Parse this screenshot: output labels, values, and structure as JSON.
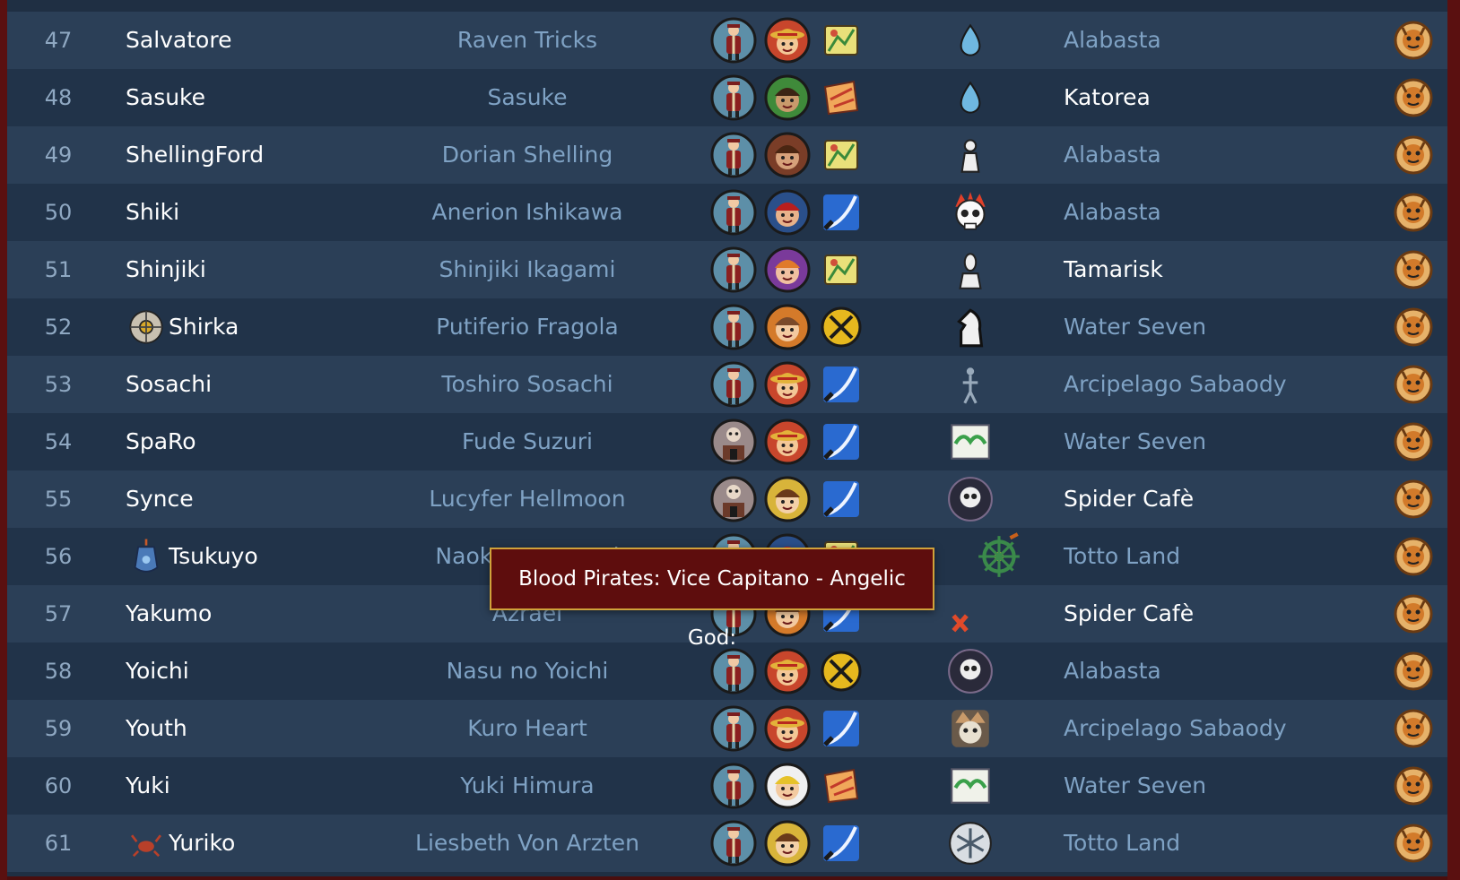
{
  "colors": {
    "row_odd": "#2b3f57",
    "row_even": "#213349",
    "number_text": "#8fa8c2",
    "nick_text": "#ffffff",
    "character_text": "#7fa2c4",
    "island_dim": "#7fa2c4",
    "island_highlight": "#ffffff",
    "tooltip_bg": "#5e0d0d",
    "tooltip_border": "#d0a23a",
    "frame_border": "#5a1010"
  },
  "tooltip": {
    "text": "Blood Pirates: Vice Capitano - Angelic God:"
  },
  "rows": [
    {
      "num": "47",
      "nick": "Salvatore",
      "character": "Raven Tricks",
      "badges": [
        "marine-officer-icon",
        "straw-hat-face-icon",
        "map-scroll-icon"
      ],
      "crew_icon": "water-drop-icon",
      "island": "Alabasta",
      "island_highlight": false,
      "action_icon": "den-den-mushi-icon"
    },
    {
      "num": "48",
      "nick": "Sasuke",
      "character": "Sasuke",
      "badges": [
        "marine-officer-icon",
        "green-face-icon",
        "broken-scroll-icon"
      ],
      "crew_icon": "water-drop-icon",
      "island": "Katorea",
      "island_highlight": true,
      "action_icon": "den-den-mushi-icon"
    },
    {
      "num": "49",
      "nick": "ShellingFord",
      "character": "Dorian Shelling",
      "badges": [
        "marine-officer-icon",
        "brown-face-icon",
        "map-scroll-icon"
      ],
      "crew_icon": "chess-pawn-icon",
      "island": "Alabasta",
      "island_highlight": false,
      "action_icon": "den-den-mushi-icon"
    },
    {
      "num": "50",
      "nick": "Shiki",
      "character": "Anerion Ishikawa",
      "badges": [
        "marine-officer-icon",
        "red-face-icon",
        "sword-slash-icon"
      ],
      "crew_icon": "flame-skull-icon",
      "island": "Alabasta",
      "island_highlight": false,
      "action_icon": "den-den-mushi-icon"
    },
    {
      "num": "51",
      "nick": "Shinjiki",
      "character": "Shinjiki Ikagami",
      "badges": [
        "marine-officer-icon",
        "purple-face-icon",
        "map-scroll-icon"
      ],
      "crew_icon": "chess-bishop-icon",
      "island": "Tamarisk",
      "island_highlight": true,
      "action_icon": "den-den-mushi-icon"
    },
    {
      "num": "52",
      "nick": "Shirka",
      "nick_icon": "compass-wheel-icon",
      "character": "Putiferio Fragola",
      "badges": [
        "marine-officer-icon",
        "orange-face-icon",
        "crossed-swords-icon"
      ],
      "crew_icon": "chess-knight-icon",
      "island": "Water Seven",
      "island_highlight": false,
      "action_icon": "den-den-mushi-icon"
    },
    {
      "num": "53",
      "nick": "Sosachi",
      "character": "Toshiro Sosachi",
      "badges": [
        "marine-officer-icon",
        "straw-hat-face-icon",
        "sword-slash-icon"
      ],
      "crew_icon": "stick-figure-icon",
      "island": "Arcipelago Sabaody",
      "island_highlight": false,
      "action_icon": "den-den-mushi-icon"
    },
    {
      "num": "54",
      "nick": "SpaRo",
      "character": "Fude Suzuri",
      "badges": [
        "warlord-icon",
        "straw-hat-face-icon",
        "sword-slash-icon"
      ],
      "crew_icon": "green-flag-icon",
      "island": "Water Seven",
      "island_highlight": false,
      "action_icon": "den-den-mushi-icon"
    },
    {
      "num": "55",
      "nick": "Synce",
      "character": "Lucyfer Hellmoon",
      "badges": [
        "warlord-icon",
        "yellow-face-icon",
        "sword-slash-icon"
      ],
      "crew_icon": "skull-orb-icon",
      "island": "Spider Cafè",
      "island_highlight": true,
      "action_icon": "den-den-mushi-icon"
    },
    {
      "num": "56",
      "nick": "Tsukuyo",
      "nick_icon": "blue-lantern-icon",
      "character": "Naoko T. Fuyumi",
      "badges": [
        "marine-officer-icon",
        "red-face-icon",
        "map-scroll-icon"
      ],
      "crew_icon": "ship-wheel-icon",
      "island": "Totto Land",
      "island_highlight": false,
      "action_icon": "den-den-mushi-icon"
    },
    {
      "num": "57",
      "nick": "Yakumo",
      "character": "Azrael",
      "badges": [
        "marine-officer-icon",
        "orange-face-icon",
        "sword-slash-icon"
      ],
      "crew_icon": "crossed-bones-icon",
      "island": "Spider Cafè",
      "island_highlight": true,
      "action_icon": "den-den-mushi-icon"
    },
    {
      "num": "58",
      "nick": "Yoichi",
      "character": "Nasu no Yoichi",
      "badges": [
        "marine-officer-icon",
        "straw-hat-face-icon",
        "crossed-swords-icon"
      ],
      "crew_icon": "skull-orb-icon",
      "island": "Alabasta",
      "island_highlight": false,
      "action_icon": "den-den-mushi-icon"
    },
    {
      "num": "59",
      "nick": "Youth",
      "character": "Kuro Heart",
      "badges": [
        "marine-officer-icon",
        "straw-hat-face-icon",
        "sword-slash-icon"
      ],
      "crew_icon": "grin-face-icon",
      "island": "Arcipelago Sabaody",
      "island_highlight": false,
      "action_icon": "den-den-mushi-icon"
    },
    {
      "num": "60",
      "nick": "Yuki",
      "character": "Yuki Himura",
      "badges": [
        "marine-officer-icon",
        "winged-face-icon",
        "broken-scroll-icon"
      ],
      "crew_icon": "green-flag-icon",
      "island": "Water Seven",
      "island_highlight": false,
      "action_icon": "den-den-mushi-icon"
    },
    {
      "num": "61",
      "nick": "Yuriko",
      "nick_icon": "red-crab-icon",
      "character": "Liesbeth Von Arzten",
      "badges": [
        "marine-officer-icon",
        "yellow-face-icon",
        "sword-slash-icon"
      ],
      "crew_icon": "snowflake-orb-icon",
      "island": "Totto Land",
      "island_highlight": false,
      "action_icon": "den-den-mushi-icon"
    }
  ]
}
